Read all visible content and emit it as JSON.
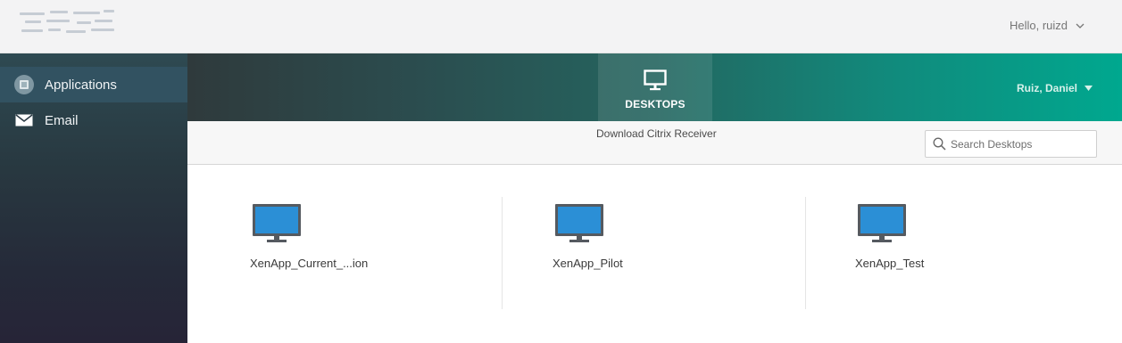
{
  "header": {
    "greeting": "Hello, ruizd"
  },
  "sidebar": {
    "items": [
      {
        "label": "Applications",
        "icon": "applications-icon",
        "active": true
      },
      {
        "label": "Email",
        "icon": "envelope-icon",
        "active": false
      }
    ]
  },
  "nav": {
    "tabs": [
      {
        "label": "DESKTOPS",
        "icon": "monitor-icon",
        "active": true
      }
    ],
    "account_label": "Ruiz, Daniel"
  },
  "toolbar": {
    "download_label": "Download Citrix Receiver",
    "search_placeholder": "Search Desktops"
  },
  "desktops": [
    {
      "name": "XenApp_Current_...ion",
      "icon": "monitor-icon"
    },
    {
      "name": "XenApp_Pilot",
      "icon": "monitor-icon"
    },
    {
      "name": "XenApp_Test",
      "icon": "monitor-icon"
    }
  ],
  "colors": {
    "accent_teal": "#00a88f",
    "sidebar_active": "#325261",
    "monitor_screen": "#2b8fd6"
  }
}
